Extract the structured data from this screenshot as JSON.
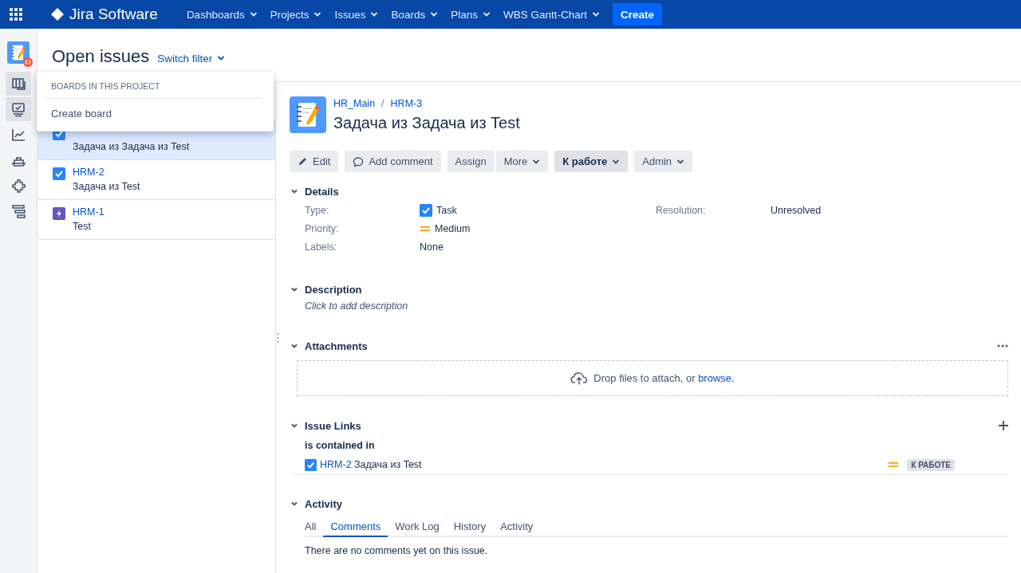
{
  "nav": {
    "product": "Jira Software",
    "menus": [
      {
        "label": "Dashboards"
      },
      {
        "label": "Projects"
      },
      {
        "label": "Issues"
      },
      {
        "label": "Boards"
      },
      {
        "label": "Plans"
      },
      {
        "label": "WBS Gantt-Chart"
      }
    ],
    "create": "Create"
  },
  "sidebar": {
    "items": [
      {
        "kind": "project",
        "selected": false
      },
      {
        "kind": "board",
        "selected": true
      },
      {
        "kind": "issues",
        "selected": true
      },
      {
        "kind": "reports",
        "selected": false
      },
      {
        "kind": "releases",
        "selected": false
      },
      {
        "kind": "components",
        "selected": false
      },
      {
        "kind": "gantt",
        "selected": false
      }
    ]
  },
  "page": {
    "title": "Open issues",
    "switch_filter": "Switch filter"
  },
  "popup": {
    "heading": "BOARDS IN THIS PROJECT",
    "items": [
      "Create board"
    ]
  },
  "issues": [
    {
      "kind": "task",
      "summary": "Задача из Задача из Test",
      "selected": true
    },
    {
      "kind": "task",
      "key": "HRM-2",
      "summary": "Задача из Test",
      "selected": false
    },
    {
      "kind": "story",
      "key": "HRM-1",
      "summary": "Test",
      "selected": false
    }
  ],
  "detail": {
    "breadcrumbs": [
      "HR_Main",
      "HRM-3"
    ],
    "breadcrumb_separator": "/",
    "title": "Задача из Задача из Test",
    "buttons": [
      {
        "kind": "edit",
        "label": "Edit"
      },
      {
        "kind": "comment",
        "label": "Add comment"
      },
      {
        "kind": "plain",
        "label": "Assign"
      },
      {
        "kind": "dropdown",
        "label": "More"
      },
      {
        "kind": "status",
        "label": "К работе"
      },
      {
        "kind": "dropdown",
        "label": "Admin"
      }
    ],
    "details": {
      "heading": "Details",
      "expanded": true,
      "left": [
        {
          "label": "Type:",
          "value": "Task",
          "kind": "task"
        },
        {
          "label": "Priority:",
          "value": "Medium",
          "kind": "medium"
        },
        {
          "label": "Labels:",
          "value": "None"
        }
      ],
      "right": [
        {
          "label": "Resolution:",
          "value": "Unresolved"
        }
      ]
    },
    "description": {
      "heading": "Description",
      "expanded": true,
      "placeholder": "Click to add description"
    },
    "attachments": {
      "heading": "Attachments",
      "expanded": true,
      "text": "Drop files to attach, or",
      "link": "browse."
    },
    "issue_links": {
      "heading": "Issue Links",
      "expanded": true,
      "relation": "is contained in",
      "links": [
        {
          "kind": "task",
          "key": "HRM-2",
          "summary": "Задача из Test",
          "priority": {
            "kind": "medium"
          },
          "status": "К РАБОТЕ"
        }
      ]
    },
    "activity": {
      "heading": "Activity",
      "expanded": true,
      "tabs": [
        {
          "label": "All",
          "selected": false
        },
        {
          "label": "Comments",
          "selected": true
        },
        {
          "label": "Work Log",
          "selected": false
        },
        {
          "label": "History",
          "selected": false
        },
        {
          "label": "Activity",
          "selected": false
        }
      ],
      "message": "There are no comments yet on this issue."
    }
  }
}
